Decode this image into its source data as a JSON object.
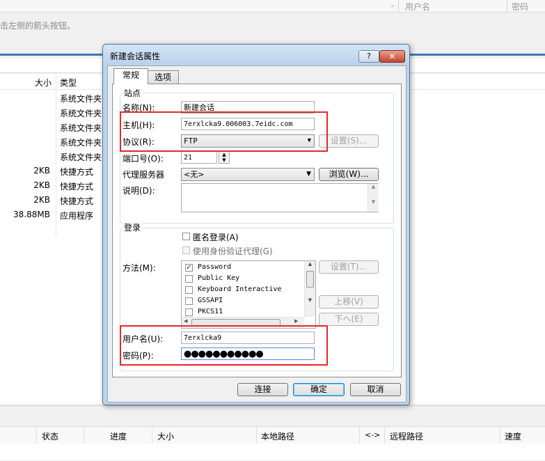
{
  "background": {
    "header_columns": [
      "用户名",
      "密码"
    ],
    "hint_text": "击左侧的箭头按钮。",
    "file_list": {
      "col_size": "大小",
      "col_type": "类型",
      "rows": [
        {
          "size": "",
          "type": "系统文件夹"
        },
        {
          "size": "",
          "type": "系统文件夹"
        },
        {
          "size": "",
          "type": "系统文件夹"
        },
        {
          "size": "",
          "type": "系统文件夹"
        },
        {
          "size": "",
          "type": "系统文件夹"
        },
        {
          "size": "2KB",
          "type": "快捷方式"
        },
        {
          "size": "2KB",
          "type": "快捷方式"
        },
        {
          "size": "2KB",
          "type": "快捷方式"
        },
        {
          "size": "38.88MB",
          "type": "应用程序"
        }
      ]
    },
    "queue_columns": {
      "status": "状态",
      "progress": "进度",
      "size": "大小",
      "local_path": "本地路径",
      "direction": "<->",
      "remote_path": "远程路径",
      "speed": "速度"
    }
  },
  "dialog": {
    "title": "新建会话属性",
    "help_label": "?",
    "close_label": "✕",
    "tabs": [
      "常规",
      "选项"
    ],
    "site_group": {
      "label": "站点",
      "name_label": "名称(N):",
      "name_value": "新建会话",
      "host_label": "主机(H):",
      "host_value": "7erxlcka9.006003.7eidc.com",
      "protocol_label": "协议(R):",
      "protocol_value": "FTP",
      "protocol_settings_button": "设置(S)...",
      "port_label": "端口号(O):",
      "port_value": "21",
      "proxy_label": "代理服务器",
      "proxy_value": "<无>",
      "browse_button": "浏览(W)...",
      "description_label": "说明(D):",
      "description_value": ""
    },
    "login_group": {
      "label": "登录",
      "anonymous_label": "匿名登录(A)",
      "use_agent_label": "使用身份验证代理(G)",
      "method_label": "方法(M):",
      "methods": [
        {
          "name": "Password",
          "checked": true
        },
        {
          "name": "Public Key",
          "checked": false
        },
        {
          "name": "Keyboard Interactive",
          "checked": false
        },
        {
          "name": "GSSAPI",
          "checked": false
        },
        {
          "name": "PKCS11",
          "checked": false
        }
      ],
      "method_settings_button": "设置(T)...",
      "move_up_button": "上移(V)",
      "move_down_button": "下へ(E)",
      "username_label": "用户名(U):",
      "username_value": "7erxlcka9",
      "password_label": "密码(P):",
      "password_value": "●●●●●●●●●●●"
    },
    "buttons": {
      "connect": "连接",
      "ok": "确定",
      "cancel": "取消"
    }
  },
  "colors": {
    "highlight_box": "#e5262b",
    "accent_blue": "#3a79b8"
  }
}
